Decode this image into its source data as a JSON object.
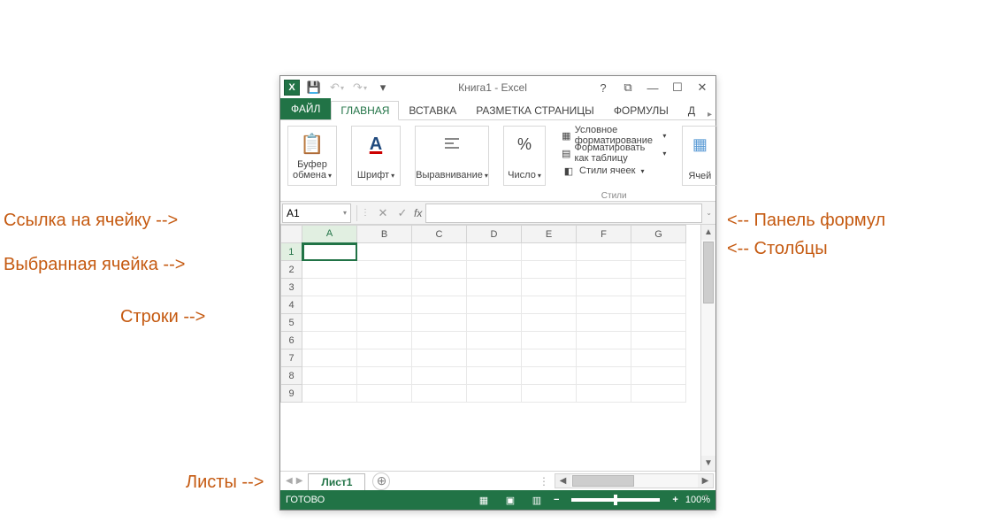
{
  "annotations": {
    "cell_ref": "Ссылка на ячейку -->",
    "selected_cell": "Выбранная ячейка -->",
    "rows": "Строки -->",
    "sheets": "Листы -->",
    "formula_bar": "<-- Панель формул",
    "columns": "<-- Столбцы"
  },
  "title": "Книга1 - Excel",
  "tabs": {
    "file": "ФАЙЛ",
    "home": "ГЛАВНАЯ",
    "insert": "ВСТАВКА",
    "page_layout": "РАЗМЕТКА СТРАНИЦЫ",
    "formulas": "ФОРМУЛЫ",
    "overflow": "Д"
  },
  "ribbon": {
    "clipboard": "Буфер обмена",
    "font": "Шрифт",
    "alignment": "Выравнивание",
    "number": "Число",
    "styles_caption": "Стили",
    "cond_fmt": "Условное форматирование",
    "fmt_table": "Форматировать как таблицу",
    "cell_styles": "Стили ячеек",
    "cells": "Ячей"
  },
  "name_box_value": "A1",
  "fx_label": "fx",
  "formula_value": "",
  "columns": [
    "A",
    "B",
    "C",
    "D",
    "E",
    "F",
    "G"
  ],
  "rows": [
    1,
    2,
    3,
    4,
    5,
    6,
    7,
    8,
    9
  ],
  "selected": {
    "row": 1,
    "col": "A"
  },
  "sheet_tab": "Лист1",
  "status": {
    "ready": "ГОТОВО",
    "zoom": "100%"
  },
  "icons": {
    "xl": "X",
    "save": "💾",
    "undo": "↶",
    "redo": "↷",
    "qa_dd": "▾",
    "help": "?",
    "restore": "⧉",
    "minimize": "—",
    "maximize": "☐",
    "close": "✕",
    "paste": "📋",
    "font_A": "A",
    "percent": "%",
    "cond_fmt": "▦",
    "table": "▤",
    "styles": "◧",
    "cells": "▦",
    "cancel": "✕",
    "enter": "✓",
    "plus": "⊕",
    "tri_left": "◀",
    "tri_right": "▶",
    "view_normal": "▦",
    "view_layout": "▣",
    "view_break": "▥"
  }
}
